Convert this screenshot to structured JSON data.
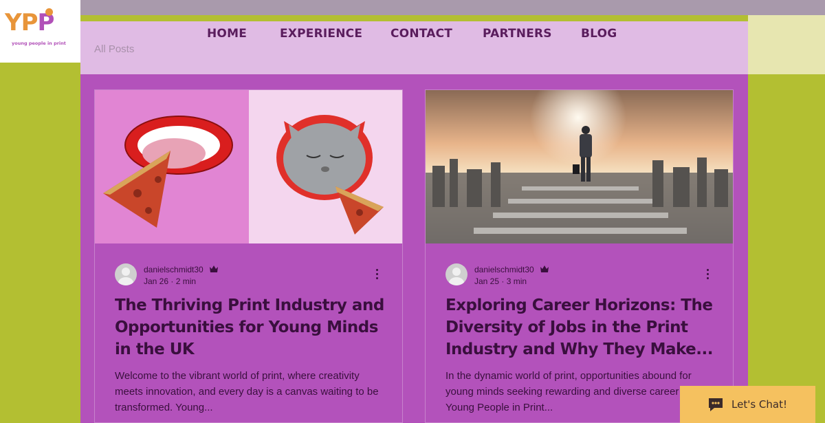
{
  "logo": {
    "letters": [
      "Y",
      "P",
      "P"
    ],
    "tagline": "young people in print"
  },
  "nav": {
    "items": [
      "HOME",
      "EXPERIENCE",
      "CONTACT",
      "PARTNERS",
      "BLOG"
    ],
    "all_posts": "All Posts"
  },
  "posts": [
    {
      "author": "danielschmidt30",
      "date": "Jan 26",
      "read_time": "2 min",
      "title": "The Thriving Print Industry and Opportunities for Young Minds in the UK",
      "excerpt": "Welcome to the vibrant world of print, where creativity meets innovation, and every day is a canvas waiting to be transformed. Young..."
    },
    {
      "author": "danielschmidt30",
      "date": "Jan 25",
      "read_time": "3 min",
      "title": "Exploring Career Horizons: The Diversity of Jobs in the Print Industry and Why They Make...",
      "excerpt": "In the dynamic world of print, opportunities abound for young minds seeking rewarding and diverse career paths. Young People in Print..."
    }
  ],
  "chat": {
    "label": "Let's Chat!"
  },
  "icons": [
    "crown-icon",
    "more-options-icon",
    "chat-icon",
    "avatar-icon"
  ],
  "colors": {
    "accent": "#b352bb",
    "nav_bg": "#e0bbe4",
    "text": "#3a0f3e",
    "chat": "#f5c15f"
  }
}
